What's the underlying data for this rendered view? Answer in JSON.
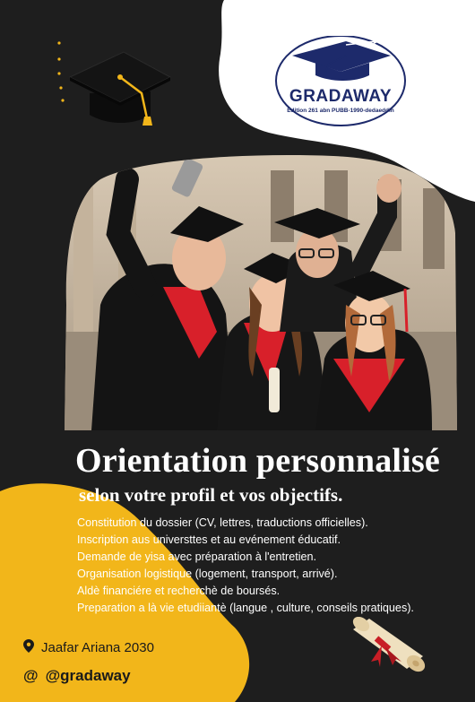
{
  "brand": {
    "name": "GRADAWAY",
    "tagline": "Edition 261 abn PUBB-1990-dedaeddin",
    "navy": "#1d2a6b"
  },
  "colors": {
    "background": "#1e1e1e",
    "accent_yellow": "#f2b61a",
    "white_shape": "#ffffff"
  },
  "headline": "Orientation personnalisé",
  "subheadline": "selon votre profil et vos objectifs.",
  "services": [
    "Constitution du dossier (CV, lettres, traductions officielles).",
    "Inscription aus universttes et au evénement éducatif.",
    "Demande de yisa avec préparation à l'entretien.",
    "Organisation logistique (logement, transport, arrivé).",
    "Aldè financiére et recherchè de boursés.",
    "Preparation a là vie etudiiantè (langue , culture, conseils pratiques)."
  ],
  "contact": {
    "location_icon": "map-pin-icon",
    "location": "Jaafar Ariana 2030",
    "handle_icon": "at-icon",
    "handle_symbol": "@",
    "handle": "@gradaway"
  },
  "photo": {
    "subject": "graduates-selfie-photo"
  }
}
